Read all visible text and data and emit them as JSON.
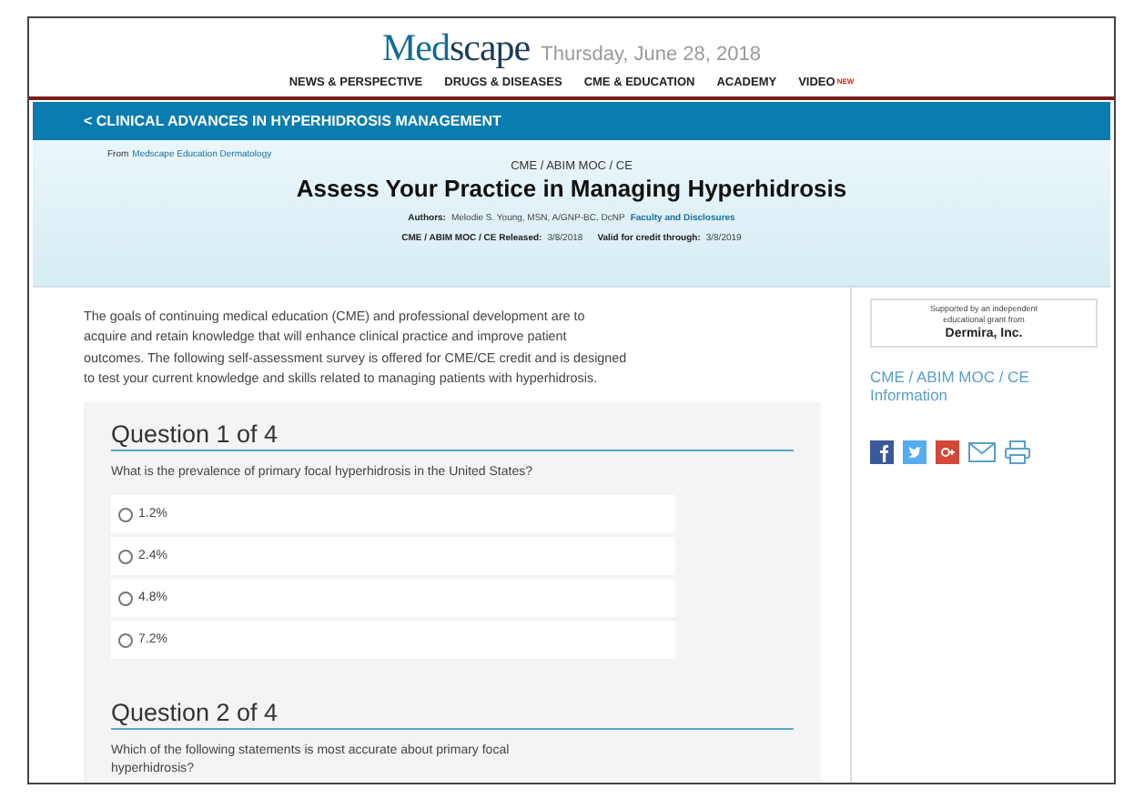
{
  "header": {
    "logo": [
      "Med",
      "scape"
    ],
    "date": "Thursday, June 28, 2018",
    "nav": [
      {
        "label": "NEWS & PERSPECTIVE"
      },
      {
        "label": "DRUGS & DISEASES"
      },
      {
        "label": "CME & EDUCATION"
      },
      {
        "label": "ACADEMY"
      },
      {
        "label": "VIDEO",
        "badge": "NEW"
      }
    ]
  },
  "banner": {
    "link": "< CLINICAL ADVANCES IN HYPERHIDROSIS MANAGEMENT"
  },
  "hero": {
    "from_label": "From",
    "from_link": "Medscape Education Dermatology",
    "category": "CME / ABIM MOC / CE",
    "title": "Assess Your Practice in Managing Hyperhidrosis",
    "authors_label": "Authors:",
    "authors": "Melodie S. Young, MSN, A/GNP-BC, DcNP",
    "disclosures_link": "Faculty and Disclosures",
    "released_label": "CME / ABIM MOC / CE Released:",
    "released": "3/8/2018",
    "valid_label": "Valid for credit through:",
    "valid": "3/8/2019"
  },
  "intro": "The goals of continuing medical education (CME) and professional development are to acquire and retain knowledge that will enhance clinical practice and improve patient outcomes. The following self-assessment survey is offered for CME/CE credit and is designed to test your current knowledge and skills related to managing patients with hyperhidrosis.",
  "questions": [
    {
      "heading": "Question 1 of 4",
      "text": "What is the prevalence of primary focal hyperhidrosis in the United States?",
      "options": [
        {
          "label": "1.2%",
          "selected": false
        },
        {
          "label": "2.4%",
          "selected": false
        },
        {
          "label": "4.8%",
          "selected": false
        },
        {
          "label": "7.2%",
          "selected": false
        }
      ]
    },
    {
      "heading": "Question 2 of 4",
      "text": "Which of the following statements is most accurate about primary focal hyperhidrosis?"
    }
  ],
  "sidebar": {
    "support_note": "Supported by an independent educational grant from",
    "sponsor": "Dermira, Inc.",
    "info_link": "CME / ABIM MOC / CE Information",
    "share": [
      {
        "kind": "facebook"
      },
      {
        "kind": "twitter"
      },
      {
        "kind": "googleplus"
      },
      {
        "kind": "email"
      },
      {
        "kind": "print"
      }
    ]
  }
}
